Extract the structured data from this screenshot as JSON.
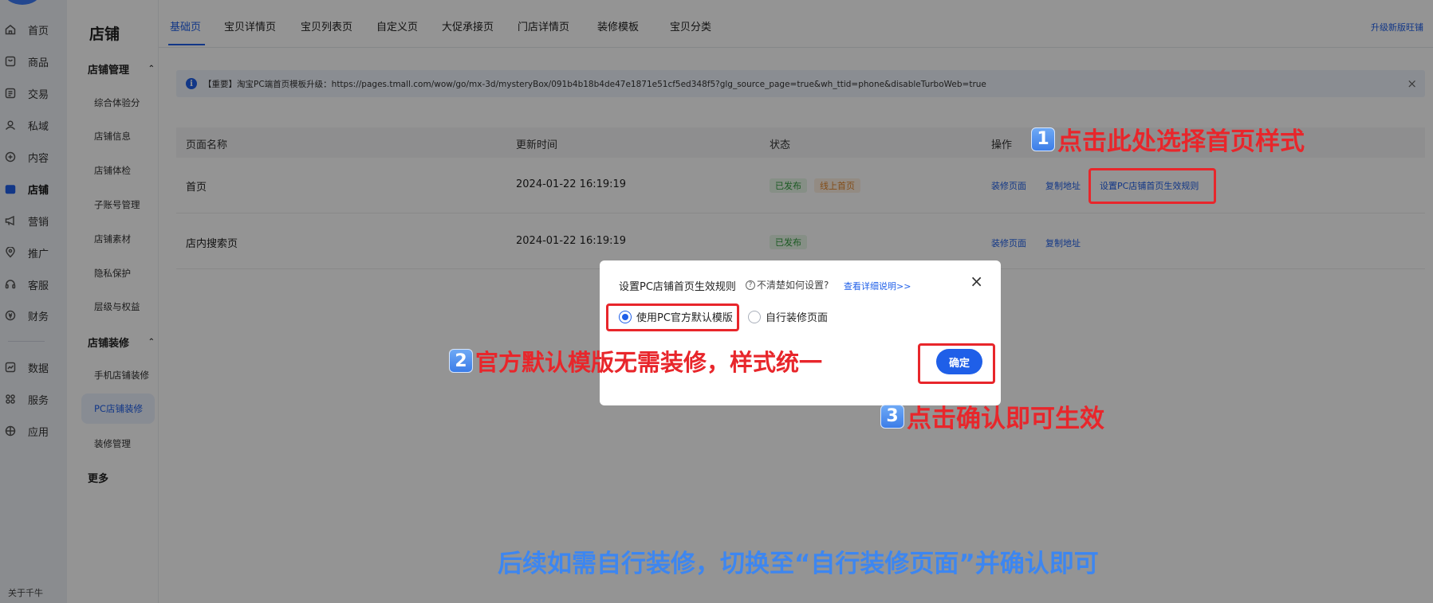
{
  "rail": {
    "items": [
      {
        "label": "首页",
        "icon": "home-icon"
      },
      {
        "label": "商品",
        "icon": "product-icon"
      },
      {
        "label": "交易",
        "icon": "order-icon"
      },
      {
        "label": "私域",
        "icon": "users-icon"
      },
      {
        "label": "内容",
        "icon": "content-icon"
      },
      {
        "label": "店铺",
        "icon": "store-icon",
        "active": true
      },
      {
        "label": "营销",
        "icon": "megaphone-icon"
      },
      {
        "label": "推广",
        "icon": "location-icon"
      },
      {
        "label": "客服",
        "icon": "headset-icon"
      },
      {
        "label": "财务",
        "icon": "finance-icon"
      },
      {
        "label": "数据",
        "icon": "chart-icon"
      },
      {
        "label": "服务",
        "icon": "grid-icon"
      },
      {
        "label": "应用",
        "icon": "apps-icon"
      }
    ],
    "footer": "关于千牛"
  },
  "sub": {
    "title": "店铺",
    "group1": "店铺管理",
    "group1_items": [
      "综合体验分",
      "店铺信息",
      "店铺体检",
      "子账号管理",
      "店铺素材",
      "隐私保护",
      "层级与权益"
    ],
    "group2": "店铺装修",
    "group2_items": [
      "手机店铺装修",
      "PC店铺装修",
      "装修管理"
    ],
    "more": "更多"
  },
  "tabs": [
    "基础页",
    "宝贝详情页",
    "宝贝列表页",
    "自定义页",
    "大促承接页",
    "门店详情页",
    "装修模板",
    "宝贝分类"
  ],
  "upgrade_link": "升级新版旺铺",
  "notice": {
    "text": "【重要】淘宝PC端首页模板升级：https://pages.tmall.com/wow/go/mx-3d/mysteryBox/091b4b18b4de47e1871e51cf5ed348f5?glg_source_page=true&wh_ttid=phone&disableTurboWeb=true",
    "close": "×",
    "info": "i"
  },
  "table": {
    "headers": [
      "页面名称",
      "更新时间",
      "状态",
      "操作"
    ],
    "rows": [
      {
        "name": "首页",
        "time": "2024-01-22 16:19:19",
        "status": [
          "已发布",
          "线上首页"
        ],
        "ops": [
          "装修页面",
          "复制地址",
          "设置PC店铺首页生效规则"
        ]
      },
      {
        "name": "店内搜索页",
        "time": "2024-01-22 16:19:19",
        "status": [
          "已发布"
        ],
        "ops": [
          "装修页面",
          "复制地址"
        ]
      }
    ]
  },
  "dialog": {
    "title": "设置PC店铺首页生效规则",
    "help": "不清楚如何设置?",
    "help_icon": "?",
    "link": "查看详细说明>>",
    "close": "×",
    "options": [
      "使用PC官方默认模版",
      "自行装修页面"
    ],
    "ok": "确定"
  },
  "annotations": {
    "step1": {
      "num": "1",
      "text": "点击此处选择首页样式"
    },
    "step2": {
      "num": "2",
      "text": "官方默认模版无需装修，样式统一"
    },
    "step3": {
      "num": "3",
      "text": "点击确认即可生效"
    },
    "bottom": "后续如需自行装修，切换至“自行装修页面”并确认即可"
  },
  "colors": {
    "accent": "#1f5fe8",
    "annotation_red": "#e8262b",
    "note_blue": "#3d86f0"
  }
}
